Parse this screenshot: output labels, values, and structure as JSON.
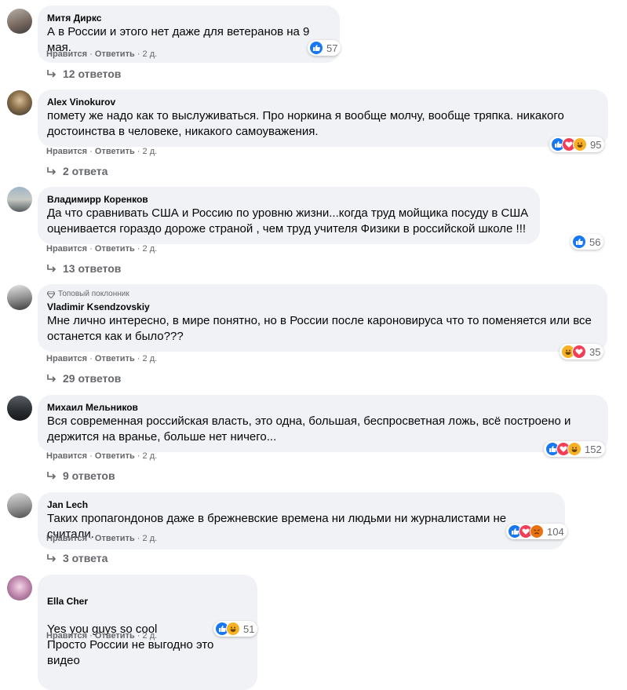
{
  "ui": {
    "like_label": "Нравится",
    "reply_label": "Ответить",
    "sep": "·",
    "colors": {
      "bubble": "#f0f2f5",
      "secondary": "#65676b",
      "like": "#1877f2",
      "love": "#f33e58",
      "haha": "#f7b125",
      "angry": "#e9710f"
    }
  },
  "comments": [
    {
      "author": "Митя Диркс",
      "text": "А в России и этого нет даже для ветеранов на 9 мая.",
      "time": "2 д.",
      "reaction_icons": [
        "like"
      ],
      "reaction_count": "57",
      "replies": "12 ответов"
    },
    {
      "author": "Alex Vinokurov",
      "text": "помету же надо как то выслуживаться. Про норкина я вообще молчу, вообще тряпка. никакого достоинства в человеке, никакого самоуважения.",
      "time": "2 д.",
      "reaction_icons": [
        "like",
        "love",
        "haha"
      ],
      "reaction_count": "95",
      "replies": "2 ответа"
    },
    {
      "author": "Владимирр Коренков",
      "text": "Да что сравнивать США и Россию по уровню жизни...когда труд мойщика посуду в США оценивается гораздо дороже страной , чем труд учителя Физики в российской школе !!!",
      "time": "2 д.",
      "reaction_icons": [
        "like"
      ],
      "reaction_count": "56",
      "replies": "13 ответов"
    },
    {
      "badge": "Топовый поклонник",
      "author": "Vladimir Ksendzovskiy",
      "text": "Мне лично интересно, в мире понятно, но в России после кароновируса что то поменяется или все останется как и было???",
      "time": "2 д.",
      "reaction_icons": [
        "haha",
        "love"
      ],
      "reaction_count": "35",
      "replies": "29 ответов"
    },
    {
      "author": "Михаил Мельников",
      "text": "Вся современная российская власть, это одна, большая, беспросветная ложь, всё построено и держится на вранье, больше нет ничего...",
      "time": "2 д.",
      "reaction_icons": [
        "like",
        "love",
        "haha"
      ],
      "reaction_count": "152",
      "replies": "9 ответов"
    },
    {
      "author": "Jan Lech",
      "text": "Таких пропагондонов даже в брежневские времена ни людьми ни журналистами не считали.",
      "time": "2 д.",
      "reaction_icons": [
        "like",
        "love",
        "angry"
      ],
      "reaction_count": "104",
      "replies": "3 ответа"
    },
    {
      "author": "Ella Cher",
      "text": "Yes you guys so cool\nПросто России не выгодно это видео",
      "time": "2 д.",
      "reaction_icons": [
        "like",
        "haha"
      ],
      "reaction_count": "51",
      "replies": ""
    }
  ]
}
